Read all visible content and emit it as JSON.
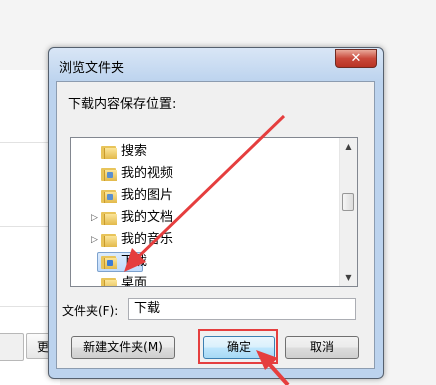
{
  "background": {
    "partial_button_label": "更"
  },
  "dialog": {
    "title": "浏览文件夹",
    "close_glyph": "✕",
    "prompt": "下载内容保存位置:",
    "tree_items": [
      {
        "label": "搜索",
        "expandable": false,
        "selected": false
      },
      {
        "label": "我的视频",
        "expandable": false,
        "selected": false
      },
      {
        "label": "我的图片",
        "expandable": false,
        "selected": false
      },
      {
        "label": "我的文档",
        "expandable": true,
        "selected": false
      },
      {
        "label": "我的音乐",
        "expandable": true,
        "selected": false
      },
      {
        "label": "下载",
        "expandable": false,
        "selected": true
      },
      {
        "label": "桌面",
        "expandable": false,
        "selected": false
      }
    ],
    "folder_label": "文件夹(F):",
    "folder_value": "下载",
    "new_folder_label": "新建文件夹(M)",
    "ok_label": "确定",
    "cancel_label": "取消"
  },
  "colors": {
    "annotation": "#e53e3e",
    "selection": "#c1dcfc",
    "close": "#c9483a"
  },
  "icons": {
    "folder": "folder-icon",
    "expander": "chevron-right-icon",
    "scroll_up": "arrow-up-icon",
    "scroll_down": "arrow-down-icon"
  }
}
